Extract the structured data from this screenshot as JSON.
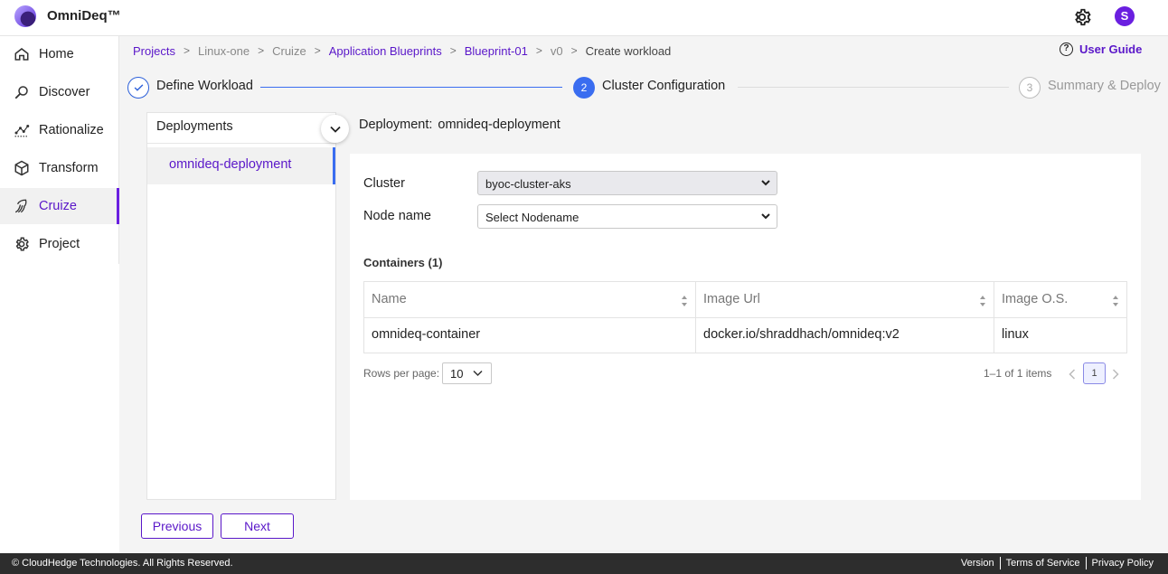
{
  "app": {
    "brand": "OmniDeq™",
    "avatar_initial": "S"
  },
  "sidebar": {
    "items": [
      {
        "label": "Home",
        "icon": "home-icon"
      },
      {
        "label": "Discover",
        "icon": "discover-icon"
      },
      {
        "label": "Rationalize",
        "icon": "rationalize-icon"
      },
      {
        "label": "Transform",
        "icon": "cube-icon"
      },
      {
        "label": "Cruize",
        "icon": "cruize-icon",
        "active": true
      },
      {
        "label": "Project",
        "icon": "gear-icon"
      }
    ]
  },
  "breadcrumbs": [
    {
      "label": "Projects",
      "style": "link"
    },
    {
      "label": "Linux-one",
      "style": "muted"
    },
    {
      "label": "Cruize",
      "style": "muted"
    },
    {
      "label": "Application Blueprints",
      "style": "link"
    },
    {
      "label": "Blueprint-01",
      "style": "link"
    },
    {
      "label": "v0",
      "style": "muted"
    },
    {
      "label": "Create workload",
      "style": "current"
    }
  ],
  "user_guide": {
    "label": "User Guide",
    "icon_glyph": "?"
  },
  "stepper": {
    "steps": [
      {
        "label": "Define Workload",
        "state": "completed"
      },
      {
        "number": "2",
        "label": "Cluster Configuration",
        "state": "active"
      },
      {
        "number": "3",
        "label": "Summary & Deploy",
        "state": "pending"
      }
    ]
  },
  "deployments": {
    "header": "Deployments",
    "items": [
      "omnideq-deployment"
    ]
  },
  "deployment_detail": {
    "label": "Deployment:",
    "name": "omnideq-deployment",
    "cluster_label": "Cluster",
    "cluster_value": "byoc-cluster-aks",
    "node_label": "Node name",
    "node_placeholder": "Select Nodename",
    "containers_title": "Containers (1)"
  },
  "table": {
    "columns": [
      "Name",
      "Image Url",
      "Image O.S."
    ],
    "rows": [
      [
        "omnideq-container",
        "docker.io/shraddhach/omnideq:v2",
        "linux"
      ]
    ]
  },
  "pagination": {
    "rows_per_page_label": "Rows per page:",
    "rows_per_page": "10",
    "items_text": "1–1 of 1 items",
    "current_page": "1"
  },
  "buttons": {
    "previous": "Previous",
    "next": "Next"
  },
  "footer": {
    "copyright": "© CloudHedge Technologies. All Rights Reserved.",
    "links": [
      "Version",
      "Terms of Service",
      "Privacy Policy"
    ]
  },
  "colors": {
    "accent": "#5a17c9",
    "step_active": "#3a6df0",
    "footer_bg": "#2d2d2d"
  }
}
